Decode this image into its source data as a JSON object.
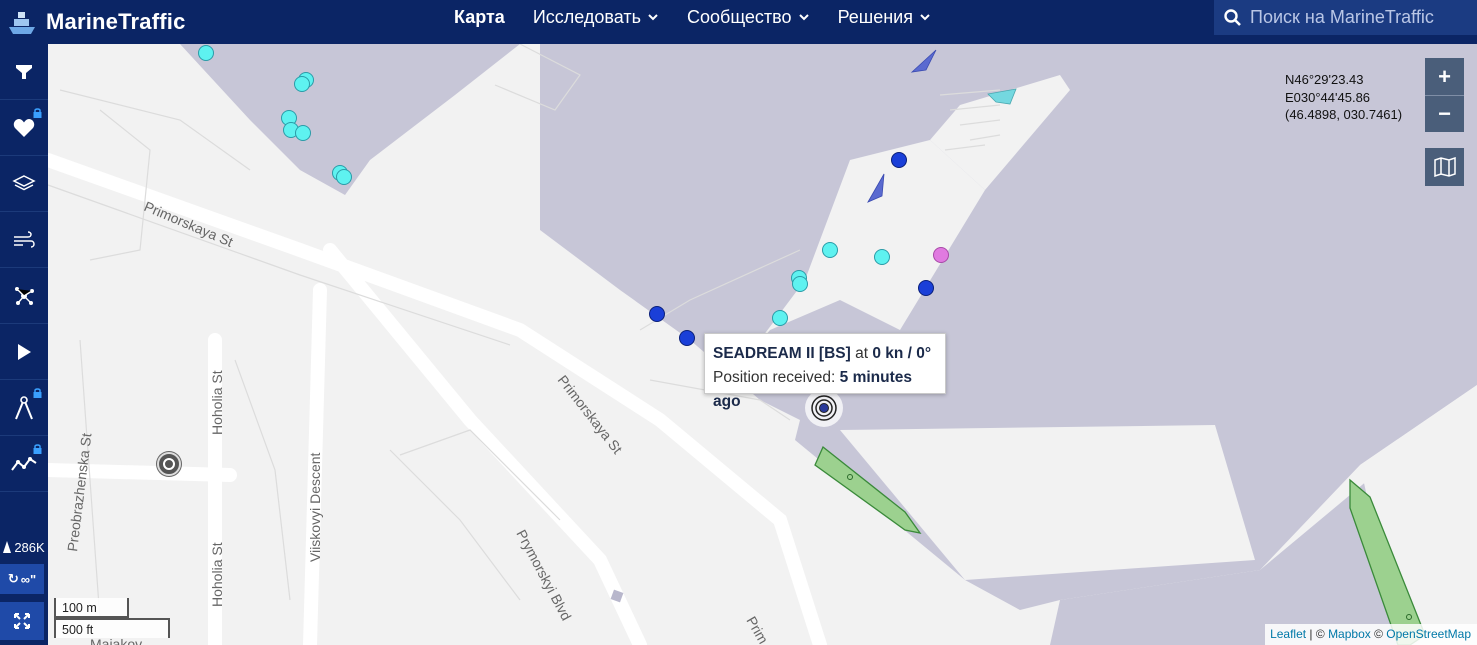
{
  "header": {
    "logo_text": "MarineTraffic",
    "nav": [
      {
        "label": "Карта",
        "active": true,
        "has_dropdown": false
      },
      {
        "label": "Исследовать",
        "active": false,
        "has_dropdown": true
      },
      {
        "label": "Сообщество",
        "active": false,
        "has_dropdown": true
      },
      {
        "label": "Решения",
        "active": false,
        "has_dropdown": true
      }
    ],
    "search_placeholder": "Поиск на MarineTraffic"
  },
  "sidebar": {
    "buttons": [
      {
        "icon": "filter-icon",
        "locked": false
      },
      {
        "icon": "heart-icon",
        "locked": true
      },
      {
        "icon": "layers-icon",
        "locked": false
      },
      {
        "icon": "wind-icon",
        "locked": false
      },
      {
        "icon": "network-icon",
        "locked": false
      },
      {
        "icon": "play-icon",
        "locked": false
      },
      {
        "icon": "measure-icon",
        "locked": true
      },
      {
        "icon": "chart-line-icon",
        "locked": true
      }
    ],
    "vessel_count": "286K",
    "tracks_label": "∞\""
  },
  "coordinates": {
    "lat": "N46°29'23.43",
    "lon": "E030°44'45.86",
    "decimal": "(46.4898, 030.7461)"
  },
  "zoom": {
    "plus": "+",
    "minus": "−"
  },
  "tooltip": {
    "vessel_name": "SEADREAM II [BS]",
    "at": "at",
    "speed_course": "0 kn / 0°",
    "position_label": "Position received:",
    "position_time": "5 minutes ago"
  },
  "scale": {
    "metric": "100 m",
    "imperial": "500 ft"
  },
  "attribution": {
    "leaflet": "Leaflet",
    "sep": " | © ",
    "mapbox": "Mapbox",
    "sep2": " © ",
    "osm": "OpenStreetMap"
  },
  "streets": [
    "Primorskaya St",
    "Primorskaya St",
    "Prymorskyi Blvd",
    "Hoholia St",
    "Hoholia St",
    "Preobrazhenska St",
    "Viiskovyi Descent",
    "Prim",
    "Majakov..."
  ],
  "colors": {
    "navy": "#0b2565",
    "water": "#c7c6d7",
    "land": "#f2f2f2",
    "passenger_marker": "#5ef2f0",
    "cargo_marker": "#1a3fd8",
    "pleasure_marker": "#e07ae0",
    "tanker_polygon": "#9cd18f"
  }
}
